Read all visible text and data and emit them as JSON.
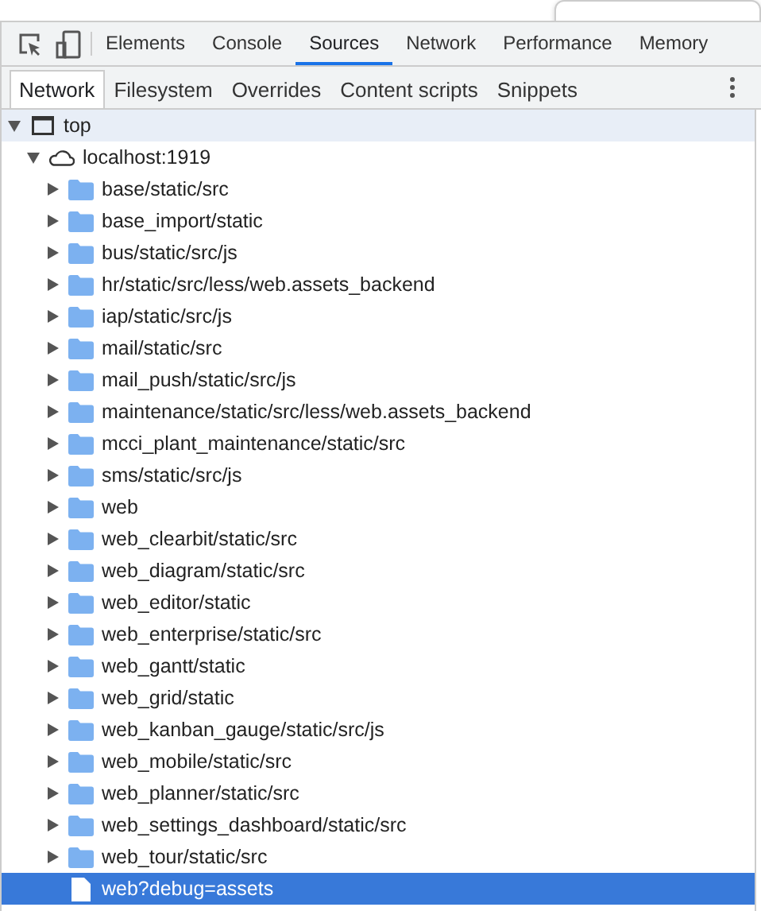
{
  "main_tabs": [
    {
      "label": "Elements",
      "selected": false
    },
    {
      "label": "Console",
      "selected": false
    },
    {
      "label": "Sources",
      "selected": true
    },
    {
      "label": "Network",
      "selected": false
    },
    {
      "label": "Performance",
      "selected": false
    },
    {
      "label": "Memory",
      "selected": false
    }
  ],
  "sub_tabs": [
    {
      "label": "Network",
      "selected": true
    },
    {
      "label": "Filesystem",
      "selected": false
    },
    {
      "label": "Overrides",
      "selected": false
    },
    {
      "label": "Content scripts",
      "selected": false
    },
    {
      "label": "Snippets",
      "selected": false
    }
  ],
  "tree": [
    {
      "kind": "frame",
      "label": "top",
      "expanded": true,
      "selected": false,
      "hovered": true,
      "children": [
        {
          "kind": "domain",
          "label": "localhost:1919",
          "expanded": true,
          "selected": false,
          "hovered": false,
          "children": [
            {
              "kind": "folder",
              "label": "base/static/src",
              "expanded": false,
              "selected": false,
              "hovered": false
            },
            {
              "kind": "folder",
              "label": "base_import/static",
              "expanded": false,
              "selected": false,
              "hovered": false
            },
            {
              "kind": "folder",
              "label": "bus/static/src/js",
              "expanded": false,
              "selected": false,
              "hovered": false
            },
            {
              "kind": "folder",
              "label": "hr/static/src/less/web.assets_backend",
              "expanded": false,
              "selected": false,
              "hovered": false
            },
            {
              "kind": "folder",
              "label": "iap/static/src/js",
              "expanded": false,
              "selected": false,
              "hovered": false
            },
            {
              "kind": "folder",
              "label": "mail/static/src",
              "expanded": false,
              "selected": false,
              "hovered": false
            },
            {
              "kind": "folder",
              "label": "mail_push/static/src/js",
              "expanded": false,
              "selected": false,
              "hovered": false
            },
            {
              "kind": "folder",
              "label": "maintenance/static/src/less/web.assets_backend",
              "expanded": false,
              "selected": false,
              "hovered": false
            },
            {
              "kind": "folder",
              "label": "mcci_plant_maintenance/static/src",
              "expanded": false,
              "selected": false,
              "hovered": false
            },
            {
              "kind": "folder",
              "label": "sms/static/src/js",
              "expanded": false,
              "selected": false,
              "hovered": false
            },
            {
              "kind": "folder",
              "label": "web",
              "expanded": false,
              "selected": false,
              "hovered": false
            },
            {
              "kind": "folder",
              "label": "web_clearbit/static/src",
              "expanded": false,
              "selected": false,
              "hovered": false
            },
            {
              "kind": "folder",
              "label": "web_diagram/static/src",
              "expanded": false,
              "selected": false,
              "hovered": false
            },
            {
              "kind": "folder",
              "label": "web_editor/static",
              "expanded": false,
              "selected": false,
              "hovered": false
            },
            {
              "kind": "folder",
              "label": "web_enterprise/static/src",
              "expanded": false,
              "selected": false,
              "hovered": false
            },
            {
              "kind": "folder",
              "label": "web_gantt/static",
              "expanded": false,
              "selected": false,
              "hovered": false
            },
            {
              "kind": "folder",
              "label": "web_grid/static",
              "expanded": false,
              "selected": false,
              "hovered": false
            },
            {
              "kind": "folder",
              "label": "web_kanban_gauge/static/src/js",
              "expanded": false,
              "selected": false,
              "hovered": false
            },
            {
              "kind": "folder",
              "label": "web_mobile/static/src",
              "expanded": false,
              "selected": false,
              "hovered": false
            },
            {
              "kind": "folder",
              "label": "web_planner/static/src",
              "expanded": false,
              "selected": false,
              "hovered": false
            },
            {
              "kind": "folder",
              "label": "web_settings_dashboard/static/src",
              "expanded": false,
              "selected": false,
              "hovered": false
            },
            {
              "kind": "folder",
              "label": "web_tour/static/src",
              "expanded": false,
              "selected": false,
              "hovered": false
            },
            {
              "kind": "file",
              "label": "web?debug=assets",
              "selected": true
            }
          ]
        }
      ]
    }
  ]
}
